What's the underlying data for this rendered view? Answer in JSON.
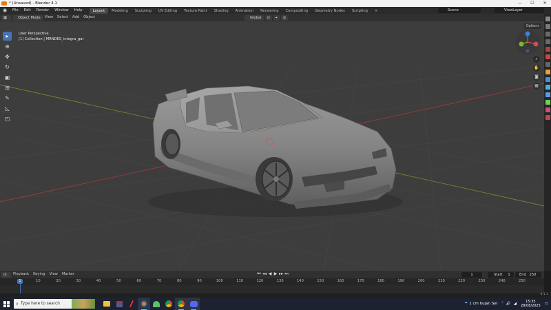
{
  "window": {
    "title": "* (Unsaved) - Blender 4.1",
    "controls": [
      "—",
      "☐",
      "✕"
    ]
  },
  "menu": [
    "File",
    "Edit",
    "Render",
    "Window",
    "Help"
  ],
  "workspaces": [
    "Layout",
    "Modeling",
    "Sculpting",
    "UV Editing",
    "Texture Paint",
    "Shading",
    "Animation",
    "Rendering",
    "Compositing",
    "Geometry Nodes",
    "Scripting",
    "+"
  ],
  "active_workspace": "Layout",
  "scene": "Scene",
  "view_layer": "ViewLayer",
  "header3d": {
    "mode": "Object Mode",
    "view": "View",
    "select": "Select",
    "add": "Add",
    "object": "Object",
    "transform_orientation": "Global",
    "options": "Options"
  },
  "viewport": {
    "perspective": "User Perspective",
    "collection": "(1) Collection | MRNDES_integra_gar"
  },
  "timeline": {
    "menus": [
      "Playback",
      "Keying",
      "View",
      "Marker"
    ],
    "current_frame": "1",
    "start_label": "Start",
    "start": "1",
    "end_label": "End",
    "end": "250",
    "ruler_ticks": [
      "10",
      "20",
      "30",
      "40",
      "50",
      "60",
      "70",
      "80",
      "90",
      "100",
      "110",
      "120",
      "130",
      "140",
      "150",
      "160",
      "170",
      "180",
      "190",
      "200",
      "210",
      "220",
      "230",
      "240",
      "250"
    ],
    "playhead": "1"
  },
  "version": "4.1.1",
  "taskbar": {
    "search_placeholder": "Type here to search",
    "weather": "1 cm hujan Sel",
    "time": "15:35",
    "date": "28/08/2025"
  },
  "colors": {
    "accent": "#4772b3",
    "blender_orange": "#e87d0d",
    "viewport_bg": "#3d3d3d",
    "x_axis": "#9a3a3a",
    "y_axis": "#6a8a2a"
  }
}
